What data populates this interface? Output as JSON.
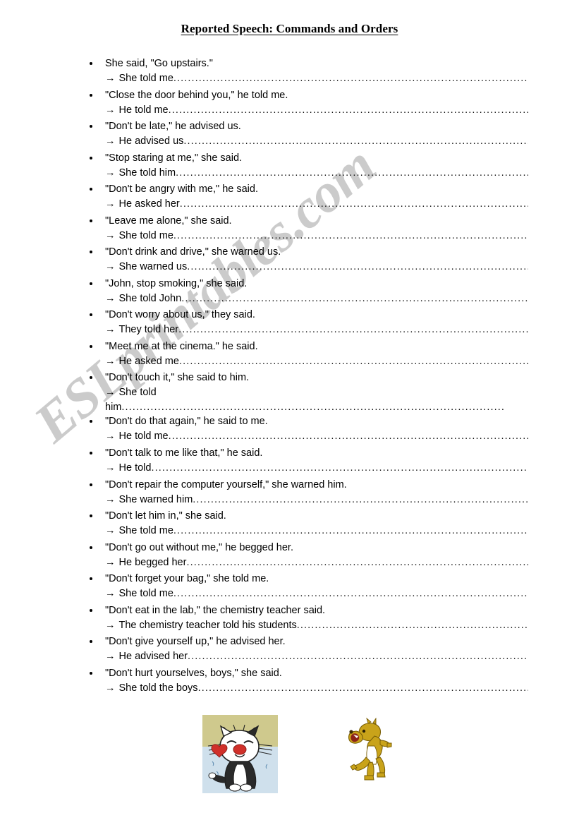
{
  "document": {
    "title": "Reported Speech: Commands and Orders",
    "watermark": "ESLprintables.com",
    "watermark_color": "#c9c9c9",
    "arrow_glyph": "→",
    "leader_dots": "......................................................................................................................................................"
  },
  "exercises": [
    {
      "quote": "She said, \"Go upstairs.\"",
      "answer": "She told me"
    },
    {
      "quote": "\"Close the door behind you,\" he told me.",
      "answer": "He told me"
    },
    {
      "quote": "\"Don't be late,\" he advised us.",
      "answer": "He advised us"
    },
    {
      "quote": "\"Stop staring at me,\" she said.",
      "answer": "She told him"
    },
    {
      "quote": "\"Don't be angry with me,\" he said.",
      "answer": "He asked her"
    },
    {
      "quote": "\"Leave me alone,\" she said.",
      "answer": "She told me"
    },
    {
      "quote": "\"Don't drink and drive,\" she warned us.",
      "answer": "She warned us"
    },
    {
      "quote": "\"John, stop smoking,\" she said.",
      "answer": "She told John"
    },
    {
      "quote": "\"Don't worry about us,\" they said.",
      "answer": "They told her"
    },
    {
      "quote": "\"Meet me at the cinema.\" he said.",
      "answer": "He asked me "
    },
    {
      "quote": "\"Don't touch it,\" she said to him.",
      "answer": "She told",
      "answer_wrap": "him"
    },
    {
      "quote": "\"Don't do that again,\" he said to me.",
      "answer": "He told me"
    },
    {
      "quote": "\"Don't talk to me like that,\" he said.",
      "answer": "He told "
    },
    {
      "quote": "\"Don't repair the computer yourself,\" she warned him.",
      "answer": "She warned him"
    },
    {
      "quote": "\"Don't let him in,\" she said.",
      "answer": "She told me"
    },
    {
      "quote": "\"Don't go out without me,\" he begged her.",
      "answer": "He begged her"
    },
    {
      "quote": "\"Don't forget your bag,\" she told me.",
      "answer": "She told me"
    },
    {
      "quote": "\"Don't eat in the lab,\" the chemistry teacher said.",
      "answer": "The chemistry teacher told his students"
    },
    {
      "quote": "\"Don't give yourself up,\" he advised her.",
      "answer": "He advised her"
    },
    {
      "quote": "\"Don't hurt yourselves, boys,\" she said.",
      "answer": "She told the boys "
    }
  ],
  "clipart": [
    {
      "name": "crying-cat-with-heart",
      "bg_top": "#cfc98d",
      "bg_bottom": "#cfe0ec",
      "accent": "#d0302a"
    },
    {
      "name": "howling-yellow-dog",
      "bg": "#ffffff",
      "accent": "#c9a31a"
    }
  ]
}
